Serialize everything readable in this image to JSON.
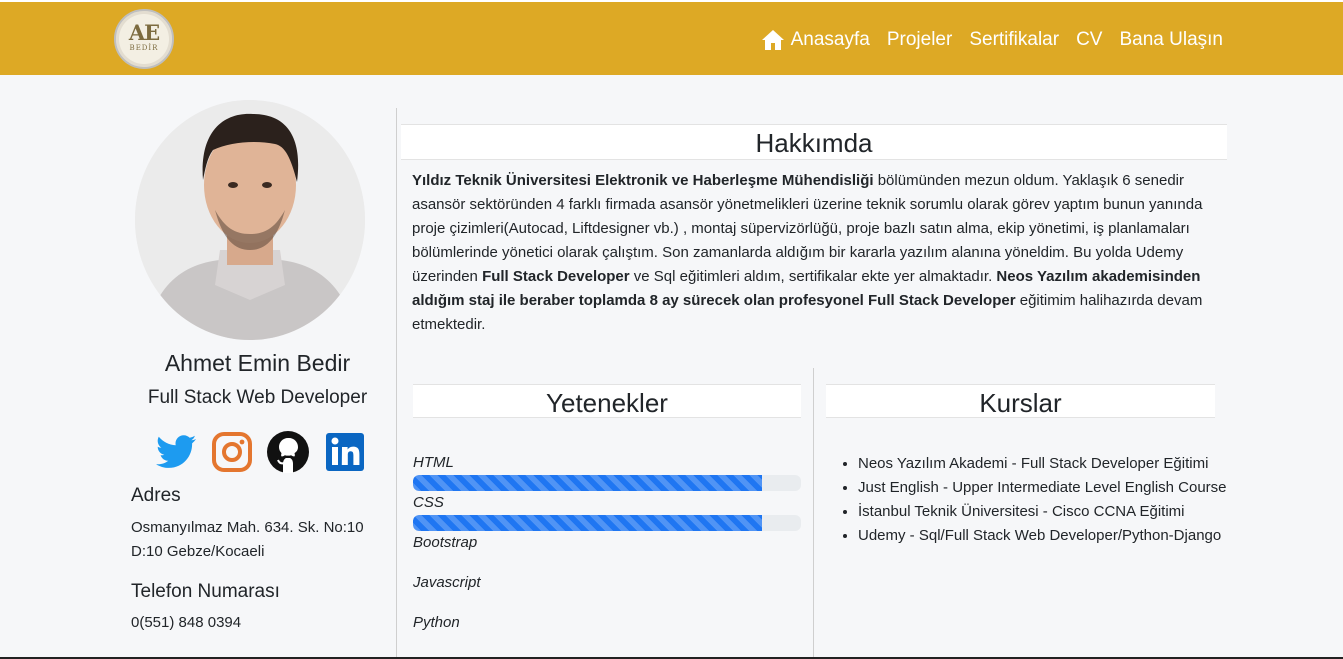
{
  "brand": {
    "logo_text": "AE",
    "logo_sub": "BEDİR",
    "color": "#dda925"
  },
  "nav": {
    "items": [
      {
        "label": "Anasayfa",
        "icon": "home-icon"
      },
      {
        "label": "Projeler"
      },
      {
        "label": "Sertifikalar"
      },
      {
        "label": "CV"
      },
      {
        "label": "Bana Ulaşın"
      }
    ]
  },
  "profile": {
    "name": "Ahmet Emin Bedir",
    "title": "Full Stack Web Developer",
    "socials": [
      "twitter-icon",
      "instagram-icon",
      "github-icon",
      "linkedin-icon"
    ],
    "address_heading": "Adres",
    "address_line1": "Osmanyılmaz Mah. 634. Sk. No:10",
    "address_line2": "D:10 Gebze/Kocaeli",
    "phone_heading": "Telefon Numarası",
    "phone": "0(551) 848 0394"
  },
  "about": {
    "heading": "Hakkımda",
    "b1": "Yıldız Teknik Üniversitesi Elektronik ve Haberleşme Mühendisliği",
    "t1": " bölümünden mezun oldum. Yaklaşık 6 senedir asansör sektöründen 4 farklı firmada asansör yönetmelikleri üzerine teknik sorumlu olarak görev yaptım bunun yanında proje çizimleri(Autocad, Liftdesigner vb.) , montaj süpervizörlüğü, proje bazlı satın alma, ekip yönetimi, iş planlamaları bölümlerinde yönetici olarak çalıştım. Son zamanlarda aldığım bir kararla yazılım alanına yöneldim. Bu yolda Udemy üzerinden ",
    "b2": "Full Stack Developer",
    "t2": " ve Sql eğitimleri aldım, sertifikalar ekte yer almaktadır. ",
    "b3": "Neos Yazılım akademisinden aldığım staj ile beraber toplamda 8 ay sürecek olan profesyonel Full Stack Developer",
    "t3": " eğitimim halihazırda devam etmektedir."
  },
  "skills": {
    "heading": "Yetenekler",
    "items": [
      {
        "label": "HTML",
        "progress": 0.9
      },
      {
        "label": "CSS",
        "progress": 0.9
      },
      {
        "label": "Bootstrap"
      },
      {
        "label": "Javascript"
      },
      {
        "label": "Python"
      }
    ],
    "bar_color": "#1f76f2"
  },
  "courses": {
    "heading": "Kurslar",
    "items": [
      "Neos Yazılım Akademi - Full Stack Developer Eğitimi",
      "Just English - Upper Intermediate Level English Course",
      "İstanbul Teknik Üniversitesi - Cisco CCNA Eğitimi",
      "Udemy - Sql/Full Stack Web Developer/Python-Django"
    ]
  }
}
